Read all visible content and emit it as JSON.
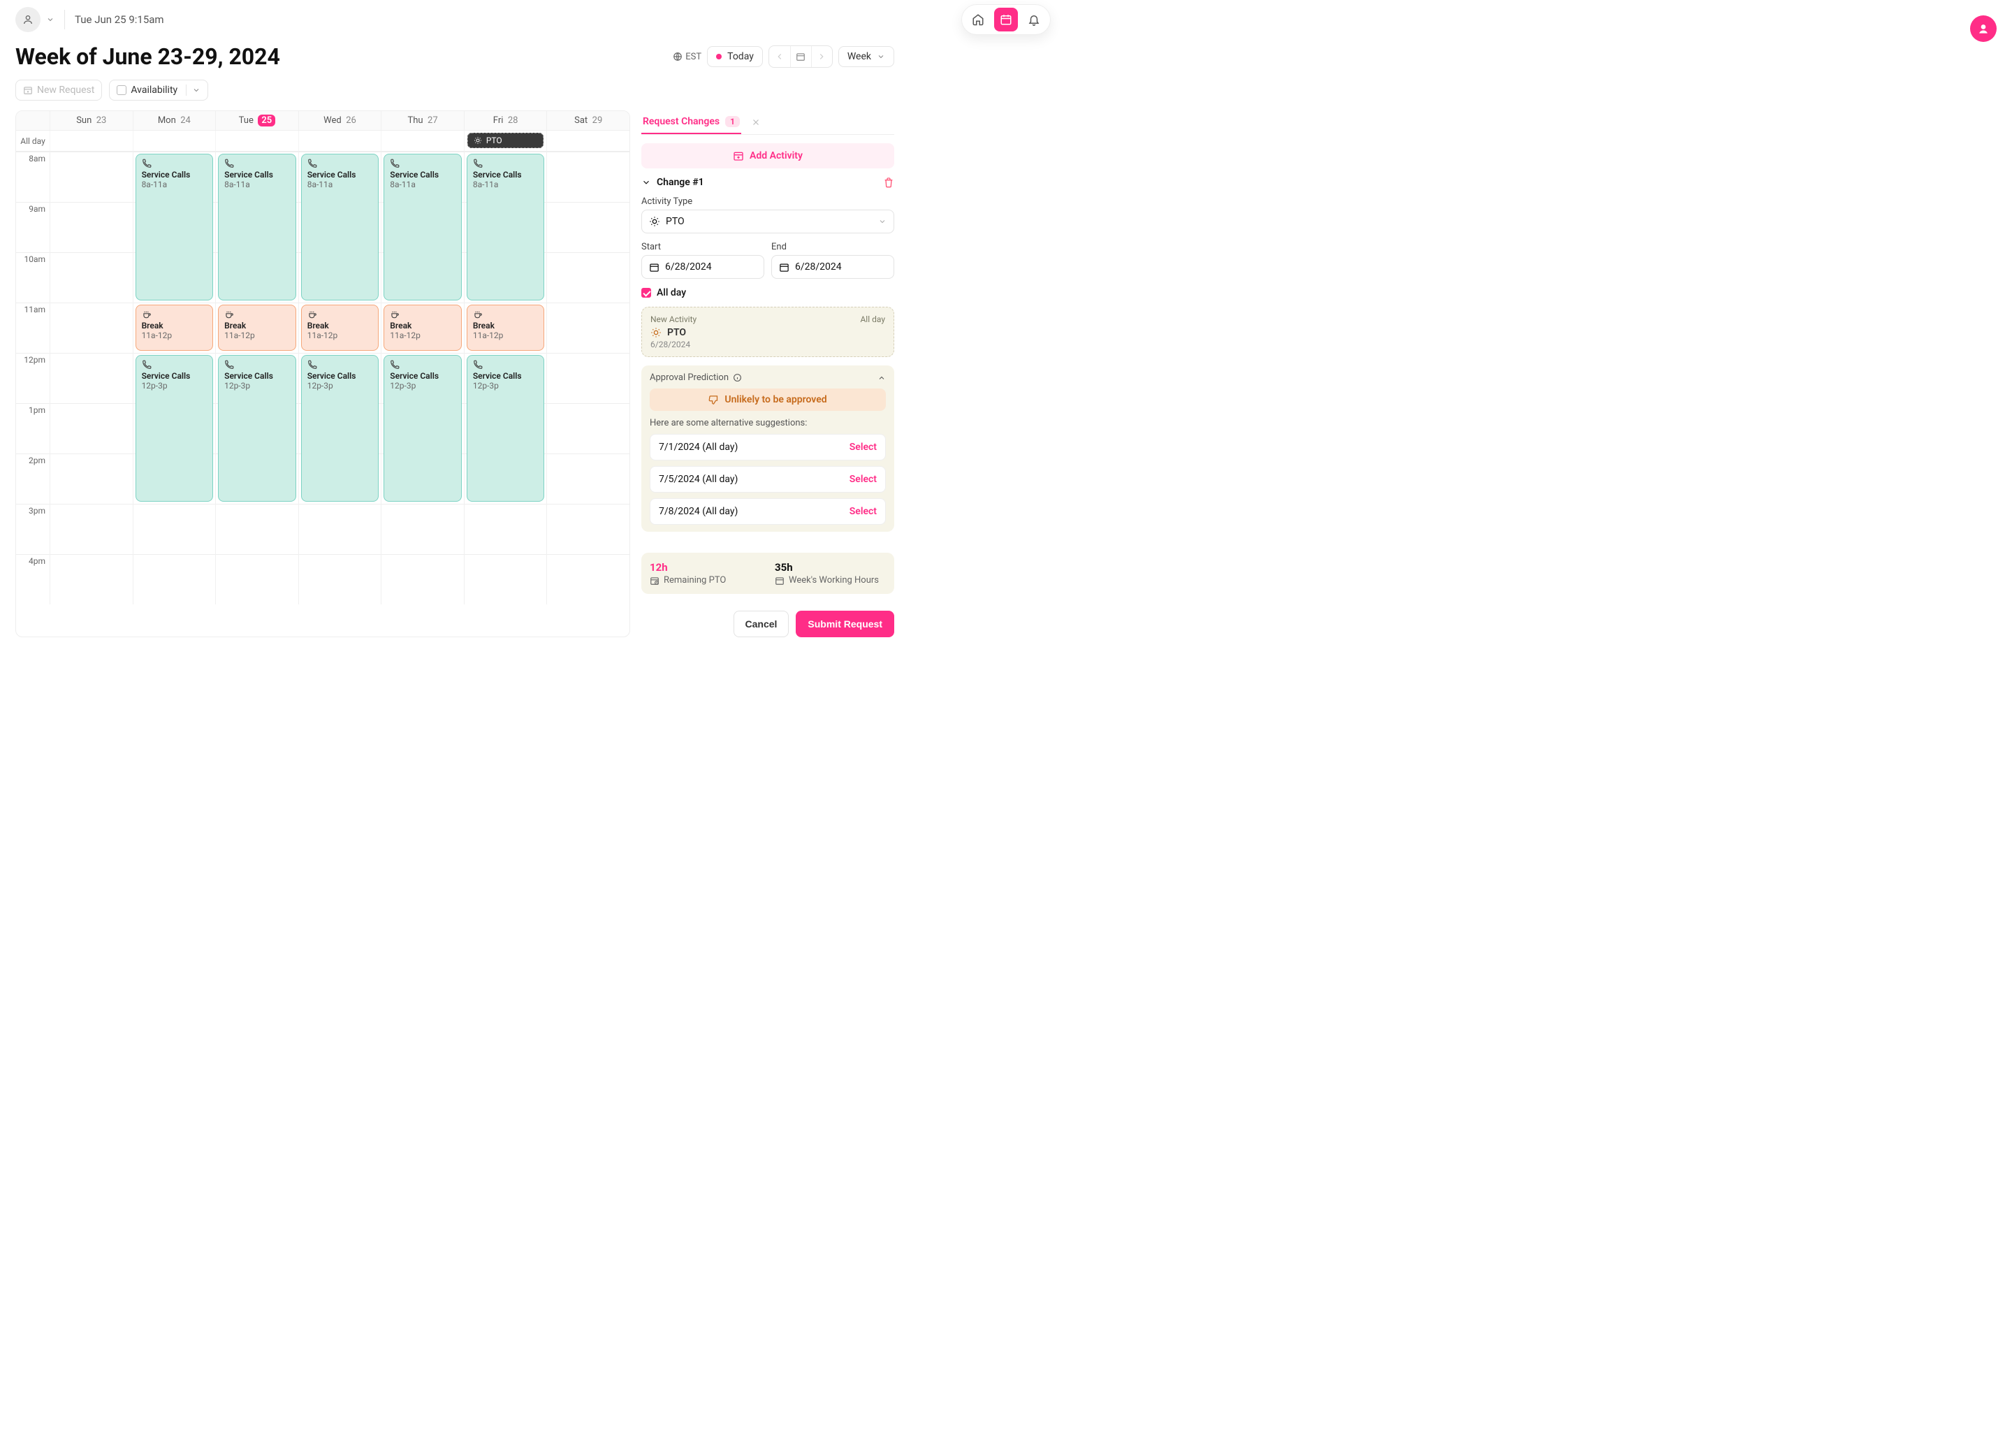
{
  "topbar": {
    "datetime": "Tue Jun 25 9:15am"
  },
  "header": {
    "title": "Week of June 23-29, 2024",
    "timezone": "EST",
    "today_label": "Today",
    "view_label": "Week"
  },
  "toolbar": {
    "new_request": "New Request",
    "availability": "Availability"
  },
  "calendar": {
    "allday_label": "All day",
    "days": [
      {
        "dow": "Sun",
        "num": "23",
        "today": false
      },
      {
        "dow": "Mon",
        "num": "24",
        "today": false
      },
      {
        "dow": "Tue",
        "num": "25",
        "today": true
      },
      {
        "dow": "Wed",
        "num": "26",
        "today": false
      },
      {
        "dow": "Thu",
        "num": "27",
        "today": false
      },
      {
        "dow": "Fri",
        "num": "28",
        "today": false
      },
      {
        "dow": "Sat",
        "num": "29",
        "today": false
      }
    ],
    "hours": [
      "8am",
      "9am",
      "10am",
      "11am",
      "12pm",
      "1pm",
      "2pm",
      "3pm",
      "4pm"
    ],
    "allday_event": {
      "day_index": 5,
      "label": "PTO"
    },
    "events": {
      "service_am": {
        "title": "Service Calls",
        "time": "8a-11a"
      },
      "break": {
        "title": "Break",
        "time": "11a-12p"
      },
      "service_pm": {
        "title": "Service Calls",
        "time": "12p-3p"
      }
    }
  },
  "panel": {
    "tab_label": "Request Changes",
    "tab_count": "1",
    "add_activity": "Add Activity",
    "change_title": "Change #1",
    "activity_type_label": "Activity Type",
    "activity_type_value": "PTO",
    "start_label": "Start",
    "start_value": "6/28/2024",
    "end_label": "End",
    "end_value": "6/28/2024",
    "allday_label": "All day",
    "new_activity": {
      "header": "New Activity",
      "allday": "All day",
      "type": "PTO",
      "date": "6/28/2024"
    },
    "approval": {
      "title": "Approval Prediction",
      "warning": "Unlikely to be approved",
      "suggestion_intro": "Here are some alternative suggestions:",
      "suggestions": [
        {
          "label": "7/1/2024 (All day)",
          "action": "Select"
        },
        {
          "label": "7/5/2024 (All day)",
          "action": "Select"
        },
        {
          "label": "7/8/2024 (All day)",
          "action": "Select"
        }
      ]
    },
    "stats": {
      "pto_value": "12h",
      "pto_label": "Remaining PTO",
      "hours_value": "35h",
      "hours_label": "Week's Working Hours"
    },
    "actions": {
      "cancel": "Cancel",
      "submit": "Submit Request"
    }
  }
}
